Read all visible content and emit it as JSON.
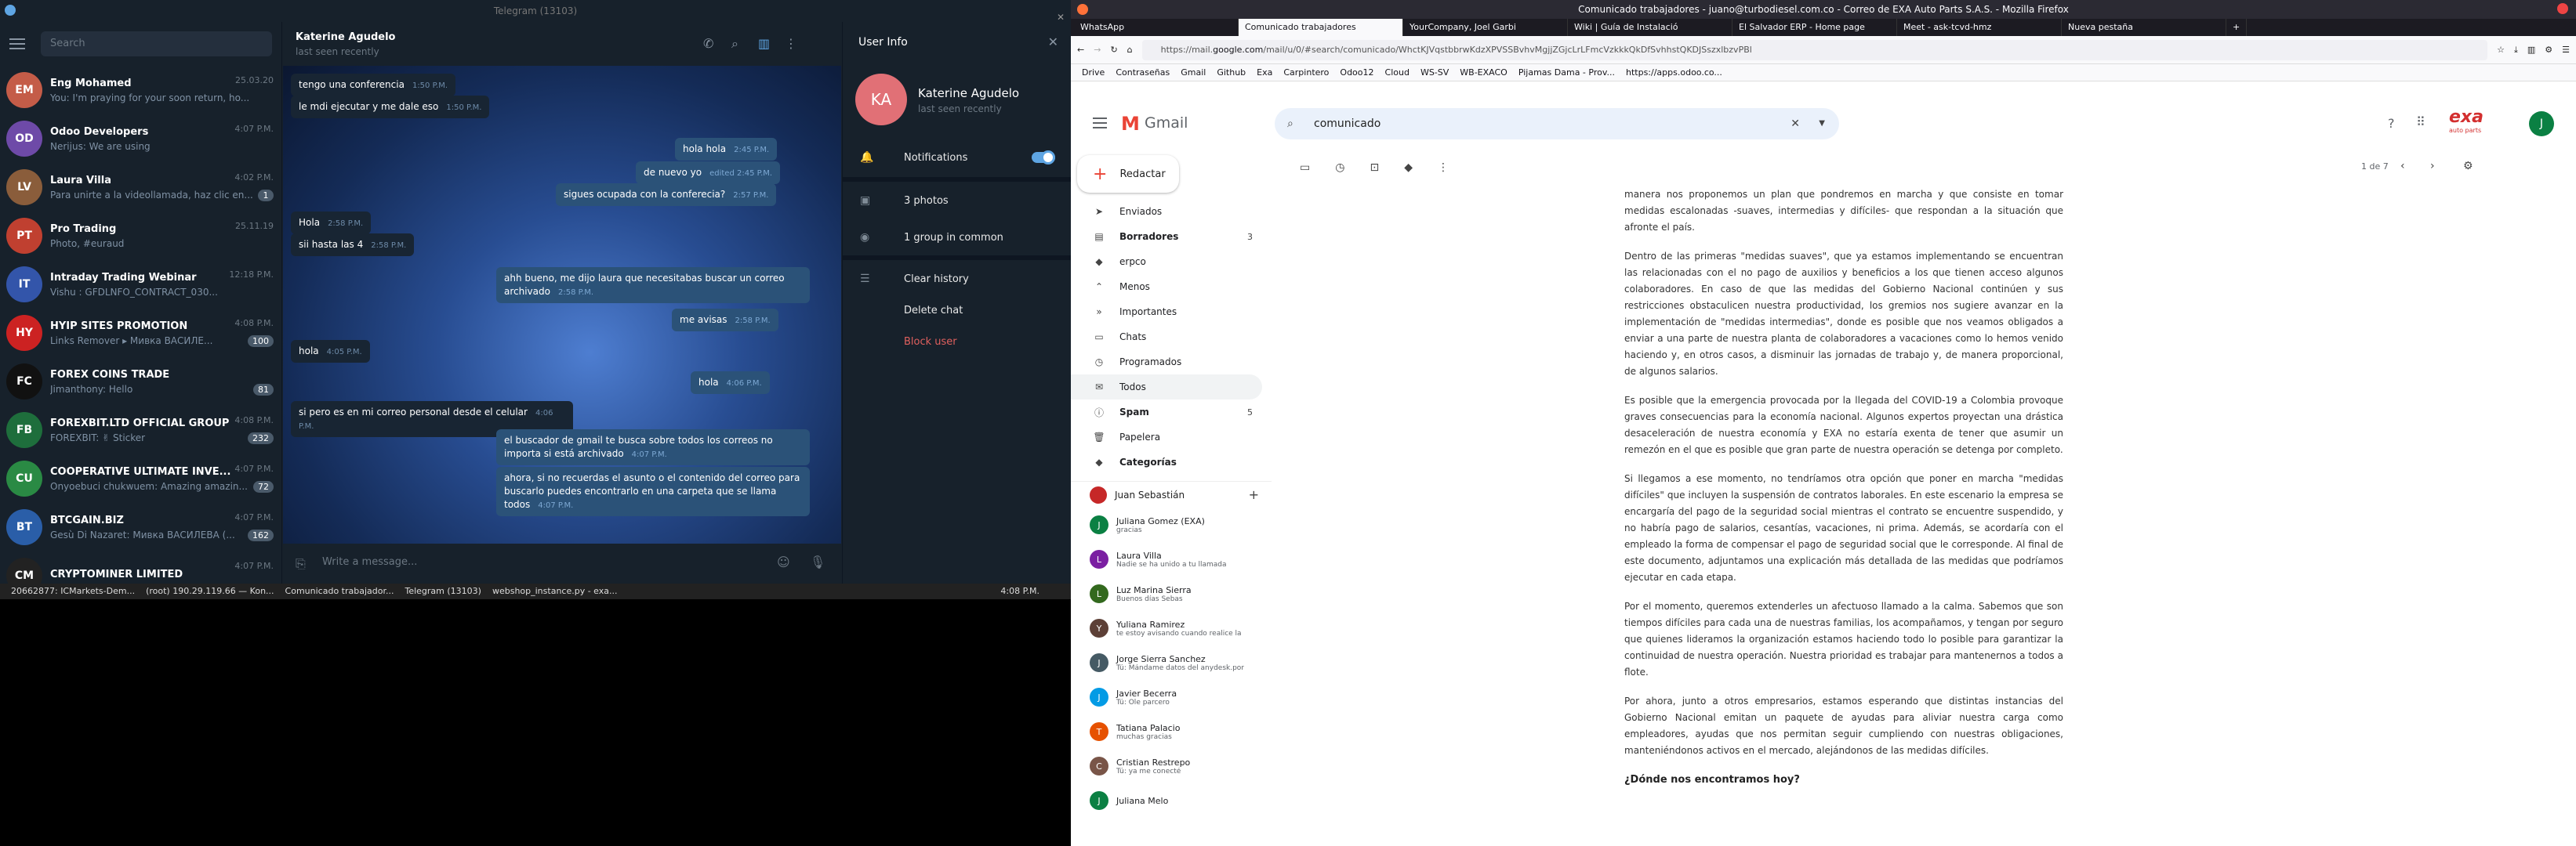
{
  "tg": {
    "title": "Telegram (13103)",
    "search_placeholder": "Search",
    "chats": [
      {
        "name": "Eng Mohamed",
        "preview": "You: I'm praying for your soon return, ho...",
        "time": "25.03.20",
        "color": "#c45c48",
        "initials": "EM"
      },
      {
        "name": "Odoo Developers",
        "preview": "Nerijus: We are using",
        "time": "4:07 P.M.",
        "color": "#6e4aa8",
        "initials": "OD",
        "group": true
      },
      {
        "name": "Laura Villa",
        "preview": "Para unirte a la videollamada, haz clic en...",
        "time": "4:02 P.M.",
        "badge": "1",
        "color": "#8a5d3b",
        "initials": "LV"
      },
      {
        "name": "Pro Trading",
        "preview": "Photo, #euraud",
        "time": "25.11.19",
        "color": "#c04030",
        "initials": "PT"
      },
      {
        "name": "Intraday Trading Webinar",
        "preview": "Vishu : GFDLNFO_CONTRACT_030...",
        "time": "12:18 P.M.",
        "color": "#3355aa",
        "initials": "IT"
      },
      {
        "name": "HYIP SITES PROMOTION",
        "preview": "Links Remover ▸ Mивка ВАСИЛЕ...",
        "time": "4:08 P.M.",
        "badge": "100",
        "color": "#cc2222",
        "initials": "HY"
      },
      {
        "name": "FOREX COINS TRADE",
        "preview": "Jimanthony: Hello",
        "time": "",
        "badge": "81",
        "color": "#111111",
        "initials": "FC"
      },
      {
        "name": "FOREXBIT.LTD OFFICIAL GROUP",
        "preview": "FOREXBIT: ✌ Sticker",
        "time": "4:08 P.M.",
        "badge": "232",
        "color": "#1e6e3c",
        "initials": "FB"
      },
      {
        "name": "COOPERATIVE ULTIMATE INVE...",
        "preview": "Onyoebuci chukwuem: Amazing amazin...",
        "time": "4:07 P.M.",
        "badge": "72",
        "color": "#2a8a44",
        "initials": "CU"
      },
      {
        "name": "BTCGAIN.BIZ",
        "preview": "Gesù Di Nazaret: Мивка ВАСИЛЕВА (...",
        "time": "4:07 P.M.",
        "badge": "162",
        "color": "#2a5ea8",
        "initials": "BT"
      },
      {
        "name": "CRYPTOMINER LIMITED",
        "preview": "",
        "time": "4:07 P.M.",
        "color": "#222222",
        "initials": "CM"
      }
    ],
    "chat": {
      "name": "Katerine Agudelo",
      "status": "last seen recently",
      "messages": [
        {
          "text": "tengo una conferencia",
          "time": "1:50 P.M.",
          "out": false
        },
        {
          "text": "le mdi ejecutar y me dale eso",
          "time": "1:50 P.M.",
          "out": false
        },
        {
          "text": "hola hola",
          "time": "2:45 P.M.",
          "out": true
        },
        {
          "text": "de nuevo yo",
          "time": "edited 2:45 P.M.",
          "out": true
        },
        {
          "text": "sigues ocupada con la conferecia?",
          "time": "2:57 P.M.",
          "out": true
        },
        {
          "text": "Hola",
          "time": "2:58 P.M.",
          "out": false
        },
        {
          "text": "sii hasta las 4",
          "time": "2:58 P.M.",
          "out": false
        },
        {
          "text": "ahh bueno, me dijo laura que necesitabas buscar un correo archivado",
          "time": "2:58 P.M.",
          "out": true
        },
        {
          "text": "me avisas",
          "time": "2:58 P.M.",
          "out": true
        },
        {
          "text": "hola",
          "time": "4:05 P.M.",
          "out": false
        },
        {
          "text": "hola",
          "time": "4:06 P.M.",
          "out": true
        },
        {
          "text": "si pero es en mi correo personal desde el celular",
          "time": "4:06 P.M.",
          "out": false
        },
        {
          "text": "el buscador de gmail te busca sobre todos los correos no importa si está archivado",
          "time": "4:07 P.M.",
          "out": true
        },
        {
          "text": "ahora, si no recuerdas el asunto o el contenido del correo para buscarlo puedes encontrarlo en una carpeta que se llama todos",
          "time": "4:07 P.M.",
          "out": true
        }
      ],
      "input_placeholder": "Write a message..."
    },
    "userinfo": {
      "title": "User Info",
      "initials": "KA",
      "name": "Katerine Agudelo",
      "status": "last seen recently",
      "notifications": "Notifications",
      "photos": "3 photos",
      "groups": "1 group in common",
      "clear": "Clear history",
      "delete": "Delete chat",
      "block": "Block user"
    }
  },
  "taskbar": {
    "items": [
      "20662877: ICMarkets-Dem...",
      "(root) 190.29.119.66 — Kon...",
      "Comunicado trabajador...",
      "Telegram (13103)",
      "webshop_instance.py - exa..."
    ],
    "clock": "4:08 P.M."
  },
  "ff": {
    "title": "Comunicado trabajadores - juano@turbodiesel.com.co - Correo de EXA Auto Parts S.A.S. - Mozilla Firefox",
    "tabs": [
      "WhatsApp",
      "Comunicado trabajadores",
      "YourCompany, Joel Garbi",
      "Wiki | Guía de Instalació",
      "El Salvador ERP - Home page",
      "Meet - ask-tcvd-hmz",
      "Nueva pestaña"
    ],
    "url_host": "https://mail.",
    "url_domain": "google.com",
    "url_path": "/mail/u/0/#search/comunicado/WhctKJVqstbbrwKdzXPVSSBvhvMgjjZGjcLrLFmcVzkkkQkDfSvhhstQKDJSszxlbzvPBl",
    "bookmarks": [
      "Drive",
      "Contraseñas",
      "Gmail",
      "Github",
      "Exa",
      "Carpintero",
      "Odoo12",
      "Cloud",
      "WS-SV",
      "WB-EXACO",
      "Pijamas Dama - Prov...",
      "https://apps.odoo.co..."
    ]
  },
  "gmail": {
    "logo": "Gmail",
    "search": "comunicado",
    "pager": "1 de 7",
    "brand": "exa",
    "brand_sub": "auto parts",
    "avatar": "J",
    "compose": "Redactar",
    "nav": [
      {
        "label": "Enviados"
      },
      {
        "label": "Borradores",
        "count": "3",
        "bold": true
      },
      {
        "label": "erpco"
      },
      {
        "label": "Menos"
      },
      {
        "label": "Importantes"
      },
      {
        "label": "Chats"
      },
      {
        "label": "Programados"
      },
      {
        "label": "Todos"
      },
      {
        "label": "Spam",
        "count": "5",
        "bold": true
      },
      {
        "label": "Papelera"
      },
      {
        "label": "Categorías",
        "bold": true
      }
    ],
    "hangouts_user": "Juan Sebastián",
    "hangouts": [
      {
        "name": "Juliana Gomez (EXA)",
        "preview": "gracias",
        "color": "#0b8043",
        "i": "J"
      },
      {
        "name": "Laura Villa",
        "preview": "Nadie se ha unido a tu llamada",
        "color": "#7b1fa2",
        "i": "L"
      },
      {
        "name": "Luz Marina Sierra",
        "preview": "Buenos días Sebas",
        "color": "#33691e",
        "i": "L"
      },
      {
        "name": "Yuliana Ramirez",
        "preview": "te estoy avisando cuando realice la",
        "color": "#5d4037",
        "i": "Y"
      },
      {
        "name": "Jorge Sierra Sanchez",
        "preview": "Tú: Mándame datos del anydesk.por",
        "color": "#455a64",
        "i": "J"
      },
      {
        "name": "Javier Becerra",
        "preview": "Tú: Ole parcero",
        "color": "#039be5",
        "i": "J"
      },
      {
        "name": "Tatiana Palacio",
        "preview": "muchas gracias",
        "color": "#e65100",
        "i": "T"
      },
      {
        "name": "Cristian Restrepo",
        "preview": "Tú: ya me conecté",
        "color": "#795548",
        "i": "C"
      },
      {
        "name": "Juliana Melo",
        "preview": "",
        "color": "#0b8043",
        "i": "J"
      }
    ],
    "paragraphs": [
      "manera nos proponemos un plan que pondremos en marcha y que consiste en tomar medidas escalonadas -suaves, intermedias y difíciles- que respondan a la situación que afronte el país.",
      "Dentro de las primeras \"medidas suaves\", que ya estamos implementando se encuentran las relacionadas con el no pago de auxilios y beneficios a los que tienen acceso algunos colaboradores. En caso de que las medidas del Gobierno Nacional continúen y sus restricciones obstaculicen nuestra productividad, los gremios nos sugiere avanzar en la implementación de \"medidas intermedias\", donde es posible que nos veamos obligados a enviar a una parte de nuestra planta de colaboradores a vacaciones como lo hemos venido haciendo y, en otros casos, a disminuir las jornadas de trabajo y, de manera proporcional, de algunos salarios.",
      "Es posible que la emergencia provocada por la llegada del COVID-19 a Colombia provoque graves consecuencias para la economía nacional. Algunos expertos proyectan una drástica desaceleración de nuestra economía y EXA no estaría exenta de tener que asumir un remezón en el que es posible que gran parte de nuestra operación se detenga por completo.",
      "Si llegamos a ese momento, no tendríamos otra opción que poner en marcha \"medidas difíciles\" que incluyen la suspensión de contratos laborales. En este escenario la empresa se encargaría del pago de la seguridad social mientras el contrato se encuentre suspendido, y no habría pago de salarios, cesantías, vacaciones, ni prima. Además, se acordaría con el empleado la forma de compensar el pago de seguridad social que le corresponde. Al final de este documento, adjuntamos una explicación más detallada de las medidas que podríamos ejecutar en cada etapa.",
      "Por el momento, queremos extenderles un afectuoso llamado a la calma. Sabemos que son tiempos difíciles para cada una de nuestras familias, los acompañamos, y tengan por seguro que quienes lideramos la organización estamos haciendo todo lo posible para garantizar la continuidad de nuestra operación. Nuestra prioridad es trabajar para mantenernos a todos a flote.",
      "Por ahora, junto a otros empresarios, estamos esperando que distintas instancias del Gobierno Nacional emitan un paquete de ayudas para aliviar nuestra carga como empleadores, ayudas que nos permitan seguir cumpliendo con nuestras obligaciones, manteniéndonos activos en el mercado, alejándonos de las medidas difíciles."
    ],
    "heading": "¿Dónde nos encontramos hoy?"
  }
}
